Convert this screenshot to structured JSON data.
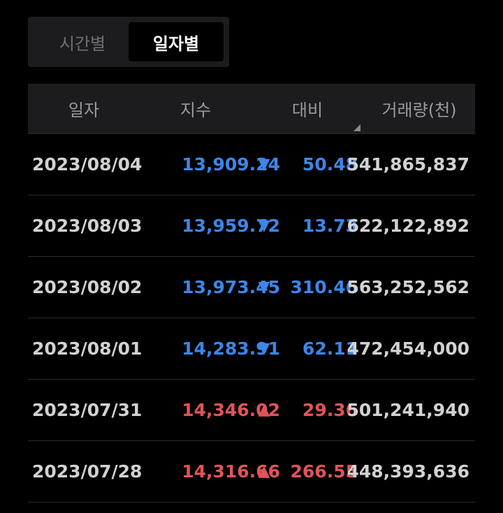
{
  "tabs": {
    "time_label": "시간별",
    "daily_label": "일자별",
    "active": "daily"
  },
  "table": {
    "headers": {
      "date": "일자",
      "index": "지수",
      "change": "대비",
      "volume": "거래량(천)"
    },
    "rows": [
      {
        "date": "2023/08/04",
        "index": "13,909.24",
        "dir": "down",
        "arrow": "▼",
        "change": "50.48",
        "volume": "541,865,837"
      },
      {
        "date": "2023/08/03",
        "index": "13,959.72",
        "dir": "down",
        "arrow": "▼",
        "change": "13.73",
        "volume": "622,122,892"
      },
      {
        "date": "2023/08/02",
        "index": "13,973.45",
        "dir": "down",
        "arrow": "▼",
        "change": "310.46",
        "volume": "563,252,562"
      },
      {
        "date": "2023/08/01",
        "index": "14,283.91",
        "dir": "down",
        "arrow": "▼",
        "change": "62.11",
        "volume": "472,454,000"
      },
      {
        "date": "2023/07/31",
        "index": "14,346.02",
        "dir": "up",
        "arrow": "▲",
        "change": "29.36",
        "volume": "501,241,940"
      },
      {
        "date": "2023/07/28",
        "index": "14,316.66",
        "dir": "up",
        "arrow": "▲",
        "change": "266.55",
        "volume": "448,393,636"
      }
    ]
  },
  "colors": {
    "down": "#3d86e8",
    "up": "#e0545a",
    "background": "#000000",
    "header_bg": "#1c1c1e"
  }
}
